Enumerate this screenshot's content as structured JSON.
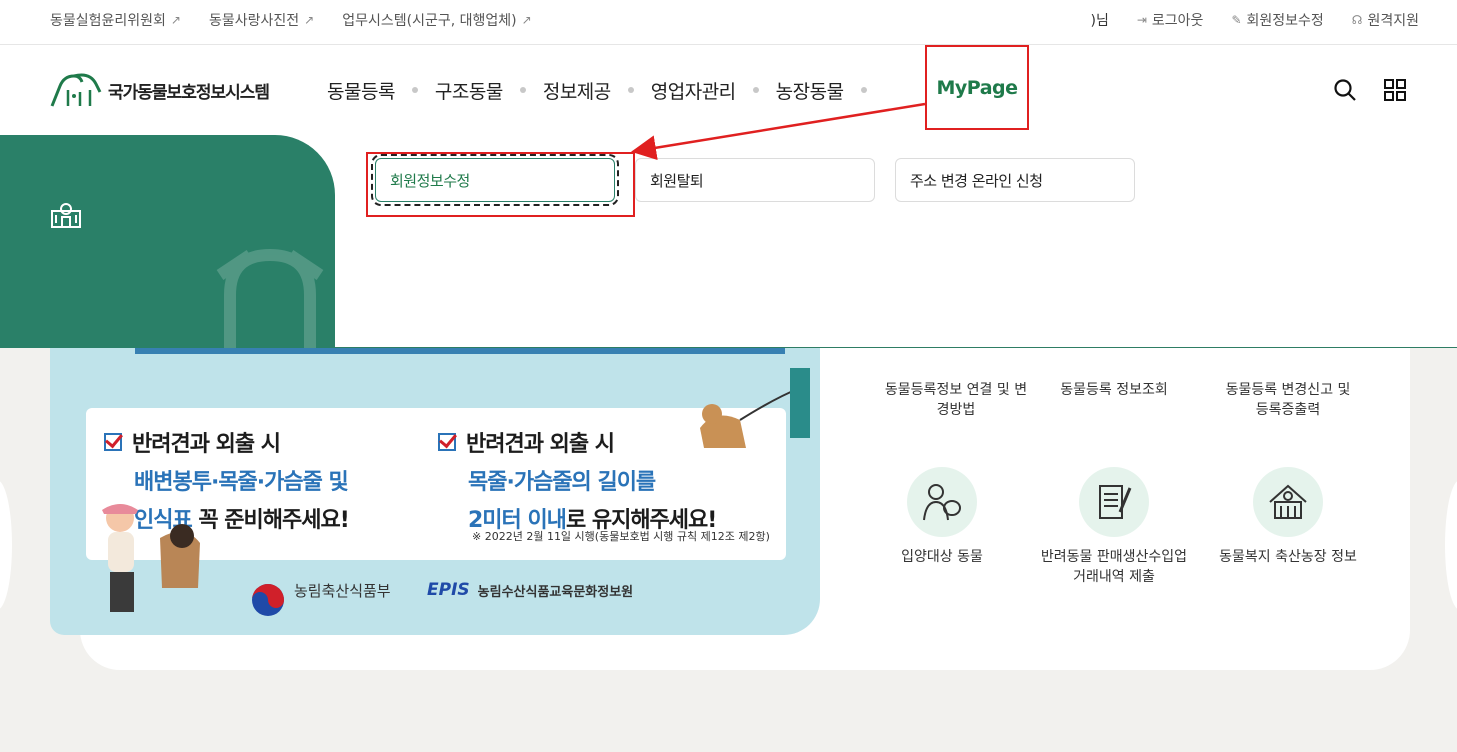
{
  "util_bar": {
    "links": [
      {
        "label": "동물실험윤리위원회",
        "icon": "external-link-icon"
      },
      {
        "label": "동물사랑사진전",
        "icon": "external-link-icon"
      },
      {
        "label": "업무시스템(시군구, 대행업체)",
        "icon": "external-link-icon"
      }
    ],
    "user_suffix": ")님",
    "logout": "로그아웃",
    "edit_info": "회원정보수정",
    "remote_support": "원격지원"
  },
  "logo": {
    "text": "국가동물보호정보시스템"
  },
  "nav": {
    "items": [
      "동물등록",
      "구조동물",
      "정보제공",
      "영업자관리",
      "농장동물",
      "MyPage"
    ],
    "active": "MyPage"
  },
  "submenu": {
    "items": [
      "회원정보수정",
      "회원탈퇴",
      "주소 변경 온라인 신청"
    ],
    "active": "회원정보수정"
  },
  "banner": {
    "col1": {
      "line1": "반려견과 외출 시",
      "line2": "배변봉투·목줄·가슴줄 및",
      "line3_hl": "인식표",
      "line3_rest": " 꼭 준비해주세요!"
    },
    "col2": {
      "line1": "반려견과 외출 시",
      "line2": "목줄·가슴줄의 길이를",
      "line3_hl": "2미터 이내",
      "line3_rest": "로 유지해주세요!"
    },
    "note": "※ 2022년 2월 11일 시행(동물보호법 시행 규칙 제12조 제2항)",
    "ministry": "농림축산식품부",
    "epis_logo": "EPIS",
    "epis_text": "농림수산식품교육문화정보원"
  },
  "quick_links": [
    {
      "label": "동물등록정보 연결 및 변경방법",
      "icon": "link-icon"
    },
    {
      "label": "동물등록 정보조회",
      "icon": "search-doc-icon"
    },
    {
      "label": "동물등록 변경신고 및 등록증출력",
      "icon": "print-icon"
    },
    {
      "label": "입양대상 동물",
      "icon": "adoption-icon"
    },
    {
      "label": "반려동물 판매생산수입업 거래내역 제출",
      "icon": "document-pen-icon"
    },
    {
      "label": "동물복지 축산농장 정보",
      "icon": "farm-icon"
    }
  ],
  "colors": {
    "brand_green": "#2a8068",
    "highlight_red": "#e02020",
    "link_blue": "#2a73b8"
  }
}
